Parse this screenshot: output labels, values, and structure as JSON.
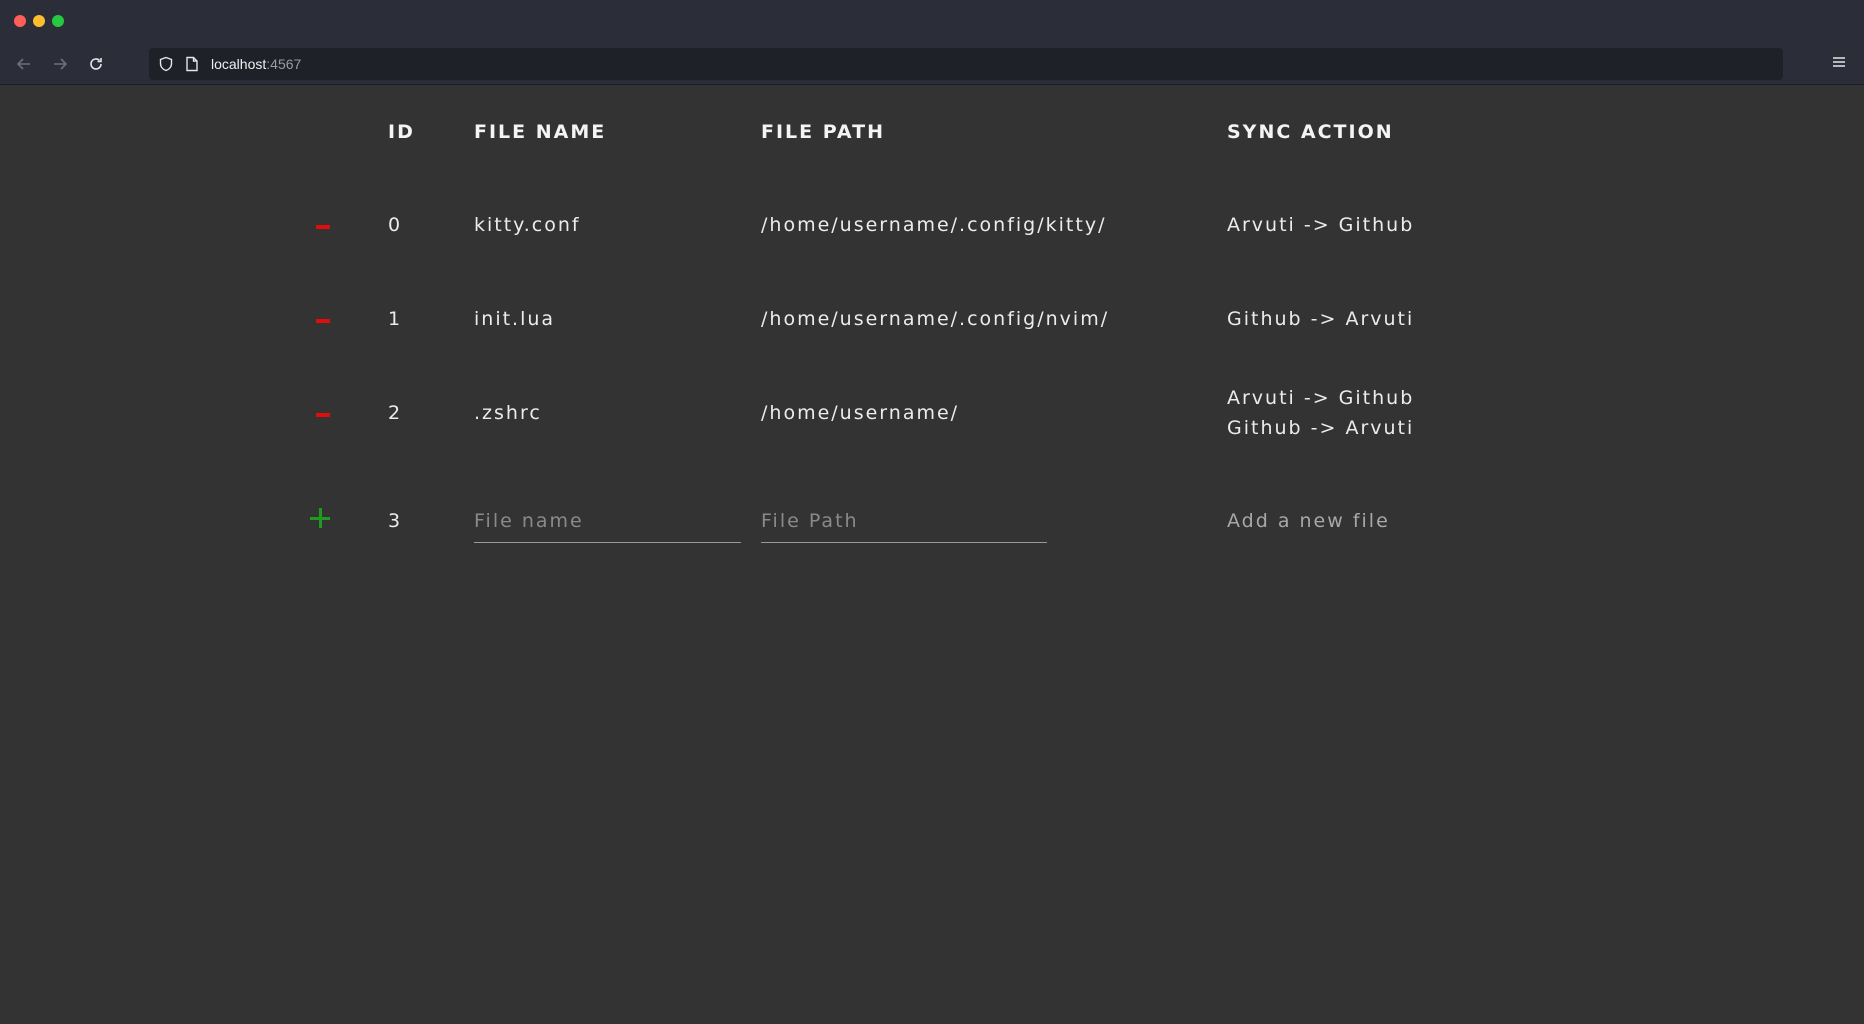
{
  "browser": {
    "url_host": "localhost",
    "url_port": ":4567"
  },
  "table": {
    "headers": {
      "id": "ID",
      "file_name": "FILE NAME",
      "file_path": "FILE PATH",
      "sync_action": "SYNC ACTION"
    },
    "rows": [
      {
        "id": "0",
        "file_name": "kitty.conf",
        "file_path": "/home/username/.config/kitty/",
        "sync": [
          "Arvuti -> Github"
        ]
      },
      {
        "id": "1",
        "file_name": "init.lua",
        "file_path": "/home/username/.config/nvim/",
        "sync": [
          "Github -> Arvuti"
        ]
      },
      {
        "id": "2",
        "file_name": ".zshrc",
        "file_path": "/home/username/",
        "sync": [
          "Arvuti -> Github",
          "Github -> Arvuti"
        ]
      }
    ],
    "new_row": {
      "id": "3",
      "file_name_placeholder": "File name",
      "file_path_placeholder": "File Path",
      "add_label": "Add a new file"
    }
  },
  "colors": {
    "background": "#333333",
    "delete": "#e00d0d",
    "add": "#1f9a1f"
  }
}
